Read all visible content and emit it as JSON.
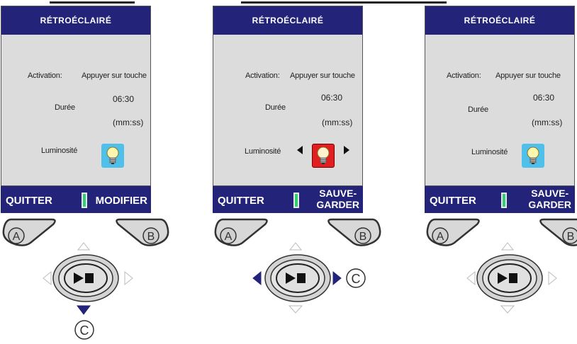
{
  "panels": [
    {
      "title": "RÉTROÉCLAIRÉ",
      "activation_label": "Activation:",
      "activation_value": "Appuyer sur touche",
      "duree_label": "Durée",
      "duree_value": "06:30",
      "duree_unit": "(mm:ss)",
      "luminosite_label": "Luminosité",
      "bulb_state": "normal",
      "softkey_left": "QUITTER",
      "softkey_right_line1": "MODIFIER",
      "softkey_right_line2": "",
      "key_a": "A",
      "key_b": "B",
      "play_stop_icon": "play-stop-icon",
      "highlighted_direction": "down",
      "callout": "C"
    },
    {
      "title": "RÉTROÉCLAIRÉ",
      "activation_label": "Activation:",
      "activation_value": "Appuyer sur touche",
      "duree_label": "Durée",
      "duree_value": "06:30",
      "duree_unit": "(mm:ss)",
      "luminosite_label": "Luminosité",
      "bulb_state": "selected",
      "softkey_left": "QUITTER",
      "softkey_right_line1": "SAUVE-",
      "softkey_right_line2": "GARDER",
      "key_a": "A",
      "key_b": "B",
      "play_stop_icon": "play-stop-icon",
      "highlighted_direction": "left-right",
      "callout": "C"
    },
    {
      "title": "RÉTROÉCLAIRÉ",
      "activation_label": "Activation:",
      "activation_value": "Appuyer sur touche",
      "duree_label": "Durée",
      "duree_value": "06:30",
      "duree_unit": "(mm:ss)",
      "luminosite_label": "Luminosité",
      "bulb_state": "normal",
      "softkey_left": "QUITTER",
      "softkey_right_line1": "SAUVE-",
      "softkey_right_line2": "GARDER",
      "key_a": "A",
      "key_b": "B",
      "play_stop_icon": "play-stop-icon",
      "highlighted_direction": "none",
      "callout": ""
    }
  ],
  "colors": {
    "header_bg": "#23237a",
    "screen_bg": "#dcdcdc",
    "bulb_blue": "#4ec0e9",
    "bulb_red": "#e02020",
    "battery_green": "#2fcf72"
  }
}
